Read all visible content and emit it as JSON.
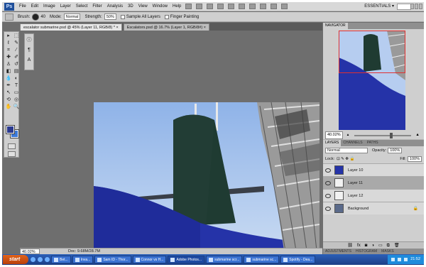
{
  "menubar": {
    "logo": "Ps",
    "items": [
      "File",
      "Edit",
      "Image",
      "Layer",
      "Select",
      "Filter",
      "Analysis",
      "3D",
      "View",
      "Window",
      "Help"
    ],
    "workspace": "ESSENTIALS ▾"
  },
  "options": {
    "brush_label": "Brush:",
    "brush_size": "40",
    "mode_label": "Mode:",
    "mode_value": "Normal",
    "strength_label": "Strength:",
    "strength_value": "50%",
    "sample_all_label": "Sample All Layers",
    "finger_label": "Finger Painting"
  },
  "tabs": [
    {
      "label": "escalator submarine.psd @ 45% (Layer 11, RGB/8) *  ×"
    },
    {
      "label": "Escalators.psd @ 16.7% (Layer 1, RGB/8#)  ×"
    }
  ],
  "status": {
    "zoom": "40.02%",
    "doc_info": "Doc: 9.68M/28.7M"
  },
  "navigator": {
    "tabs": [
      "NAVIGATOR"
    ],
    "zoom": "40.02%"
  },
  "layers": {
    "tabs": [
      "LAYERS",
      "CHANNELS",
      "PATHS"
    ],
    "blend_mode": "Normal",
    "opacity_label": "Opacity:",
    "opacity_value": "100%",
    "lock_label": "Lock:",
    "fill_label": "Fill:",
    "fill_value": "100%",
    "rows": [
      {
        "name": "Layer 10"
      },
      {
        "name": "Layer 11"
      },
      {
        "name": "Layer 12"
      },
      {
        "name": "Background",
        "lock": "🔒"
      }
    ]
  },
  "bottom_tabs": [
    "ADJUSTMENTS",
    "HISTOGRAM",
    "MASKS"
  ],
  "taskbar": {
    "start": "start",
    "buttons": [
      "Bet...",
      "Inva...",
      "Sam ID - Thor...",
      "Connor vs H...",
      "Adobe Photos...",
      "submarine scr...",
      "submarine sc...",
      "Spotify - Dea..."
    ],
    "clock": "21:52"
  },
  "colors": {
    "foreground": "#2b3a8f",
    "background": "#3c79d8",
    "app_bg": "#6e6e6e"
  }
}
